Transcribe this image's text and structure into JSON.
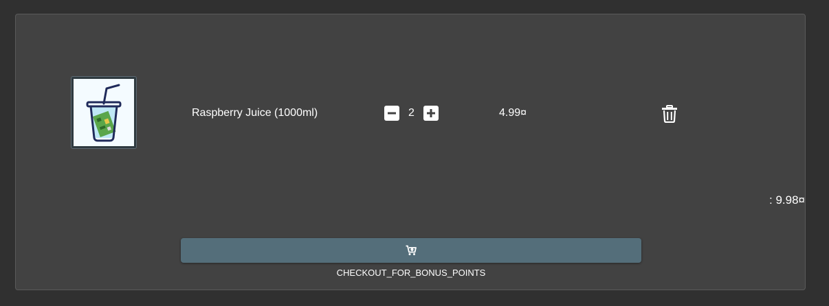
{
  "basket": {
    "items": [
      {
        "name": "Raspberry Juice (1000ml)",
        "quantity": "2",
        "price": "4.99¤"
      }
    ],
    "total": ": 9.98¤",
    "checkout_icon": "cart-arrow-down-icon",
    "bonus_text": "CHECKOUT_FOR_BONUS_POINTS"
  },
  "colors": {
    "background": "#303030",
    "card": "#424242",
    "checkout_button": "#546e7a",
    "text": "#ffffff"
  }
}
